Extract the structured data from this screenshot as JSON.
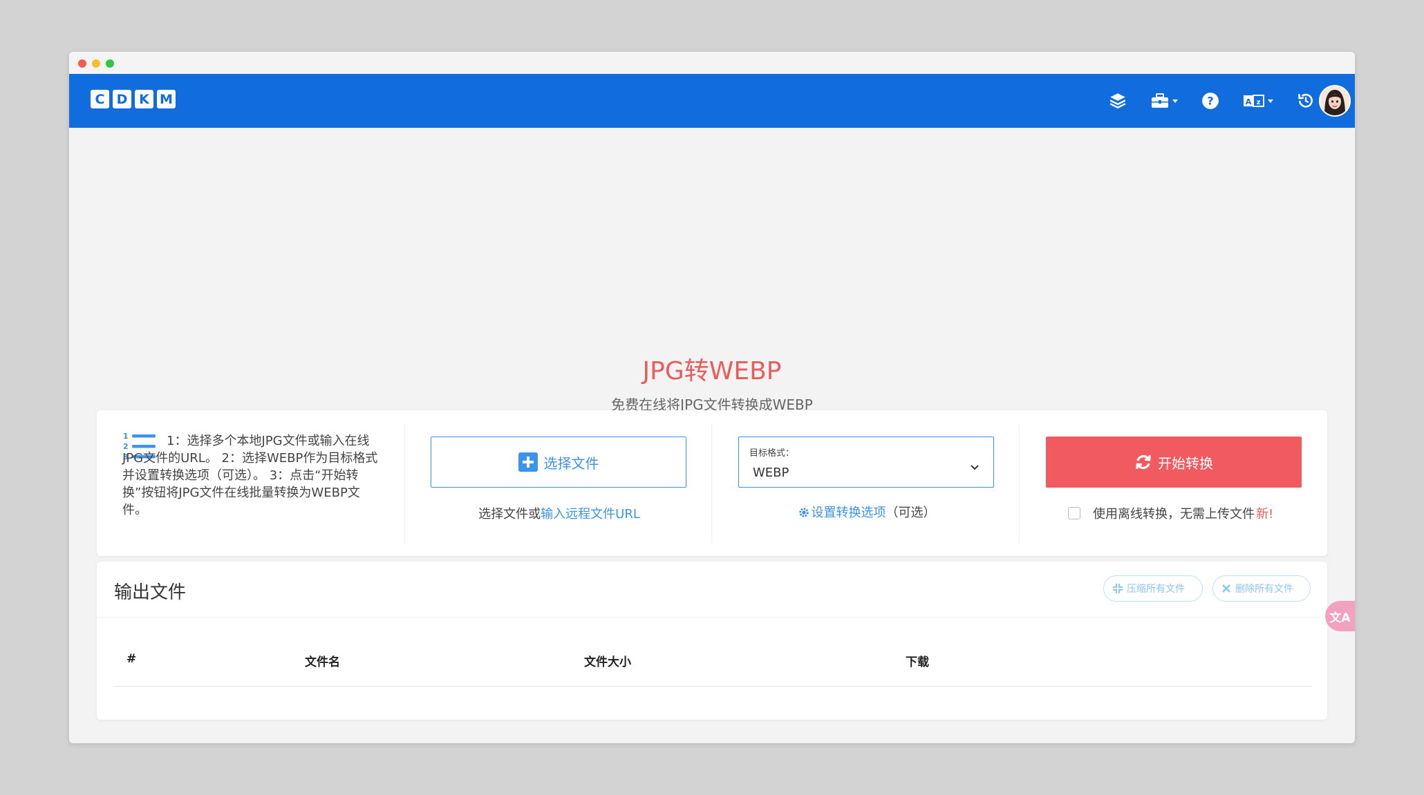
{
  "logo": {
    "letters": [
      "C",
      "D",
      "K",
      "M"
    ]
  },
  "nav": {
    "icons": [
      "layers-icon",
      "toolbox-icon",
      "help-icon",
      "translate-icon",
      "history-icon"
    ]
  },
  "hero": {
    "title": "JPG转WEBP",
    "subtitle": "免费在线将JPG文件转换成WEBP"
  },
  "steps": {
    "text": "1：选择多个本地JPG文件或输入在线JPG文件的URL。 2：选择WEBP作为目标格式并设置转换选项（可选）。 3：点击“开始转换”按钮将JPG文件在线批量转换为WEBP文件。"
  },
  "file_select": {
    "button_label": "选择文件",
    "hint_prefix": "选择文件或",
    "hint_link": "输入远程文件URL"
  },
  "format": {
    "label": "目标格式：",
    "value": "WEBP",
    "options_link": "设置转换选项",
    "options_suffix": "（可选）"
  },
  "convert": {
    "button_label": "开始转换",
    "offline_label": "使用离线转换，无需上传文件",
    "new_badge": "新!"
  },
  "output": {
    "title": "输出文件",
    "compress_label": "压缩所有文件",
    "delete_label": "删除所有文件",
    "columns": [
      "#",
      "文件名",
      "文件大小",
      "下载"
    ]
  },
  "float": {
    "label": "文A"
  },
  "colors": {
    "brand_blue": "#116cdd",
    "accent_red": "#f15b60",
    "link_blue": "#3b93ea"
  }
}
